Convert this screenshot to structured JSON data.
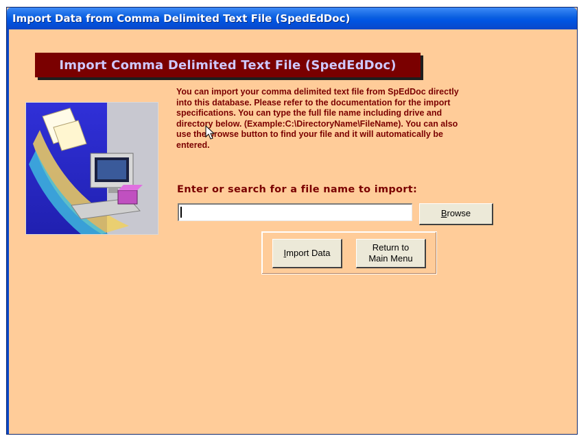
{
  "window": {
    "title": "Import Data from Comma Delimited Text File (SpedEdDoc)"
  },
  "banner": {
    "text": "Import Comma Delimited Text File (SpedEdDoc)"
  },
  "info": {
    "text": "You can import your comma delimited text file from SpEdDoc directly into this database.  Please refer to the documentation for the import specifications.  You can type the full file name including drive and directory below. (Example:C:\\DirectoryName\\FileName). You can also use the browse button to find your file and it will automatically be entered."
  },
  "file_prompt": {
    "label": "Enter or search for a file name to import:",
    "value": ""
  },
  "buttons": {
    "browse": {
      "prefix": "",
      "mnemonic": "B",
      "rest": "rowse"
    },
    "import_data": {
      "prefix": "",
      "mnemonic": "I",
      "rest": "mport Data"
    },
    "return_line1": "Return to",
    "return_line2": "Main Menu"
  },
  "colors": {
    "form_background": "#ffcc99",
    "banner_background": "#7a0000",
    "banner_text": "#cfc9ff",
    "text_maroon": "#7a0000",
    "titlebar": "#0054e3"
  },
  "icons": {
    "picture": "computer-import-illustration",
    "cursor": "mouse-pointer-icon"
  }
}
